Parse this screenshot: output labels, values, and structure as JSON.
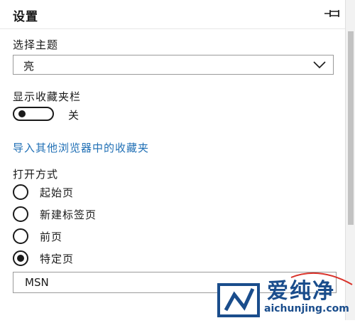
{
  "panel": {
    "title": "设置"
  },
  "theme": {
    "label": "选择主题",
    "selected": "亮"
  },
  "favorites_bar": {
    "label": "显示收藏夹栏",
    "state_text": "关"
  },
  "import_link": "导入其他浏览器中的收藏夹",
  "open_with": {
    "label": "打开方式",
    "options": [
      {
        "label": "起始页",
        "checked": false
      },
      {
        "label": "新建标签页",
        "checked": false
      },
      {
        "label": "前页",
        "checked": false
      },
      {
        "label": "特定页",
        "checked": true
      }
    ],
    "page_value": "MSN"
  },
  "watermark": {
    "name": "爱纯净",
    "url": "aichunjing.com"
  },
  "colors": {
    "link": "#1f6fb5",
    "watermark": "#1a4d8c",
    "watermark_accent": "#d9322a"
  }
}
